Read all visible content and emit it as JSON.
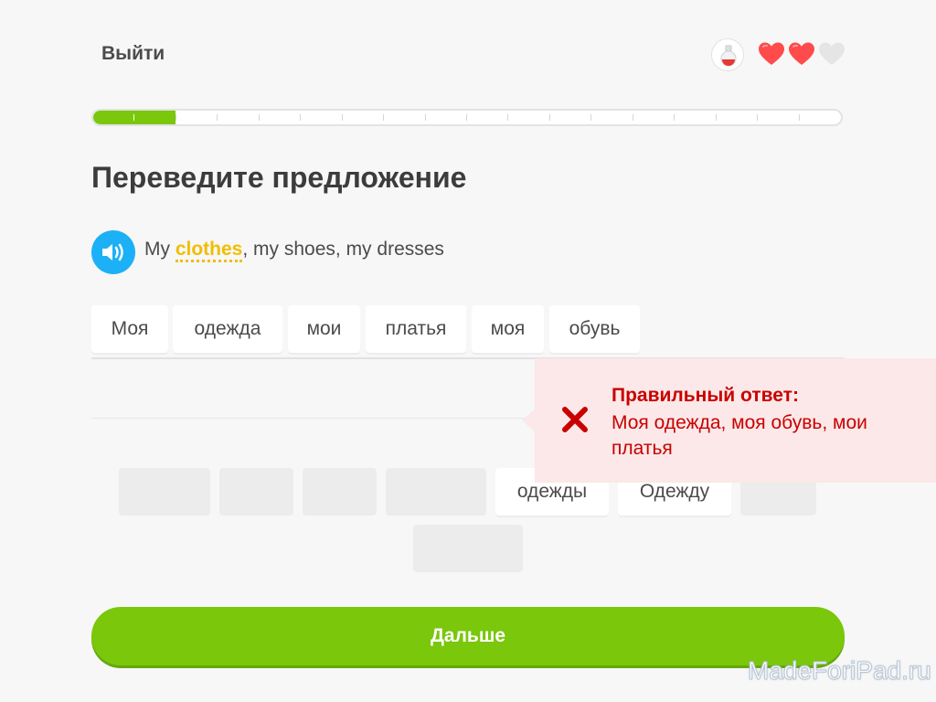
{
  "header": {
    "quit_label": "Выйти",
    "hearts": {
      "total": 3,
      "remaining": 2
    }
  },
  "progress": {
    "fraction": 0.11,
    "segments": 18
  },
  "exercise": {
    "instruction": "Переведите предложение",
    "prompt_before": "My ",
    "prompt_hint": "clothes",
    "prompt_after": ", my shoes, my dresses"
  },
  "answer_words": [
    "Моя",
    "одежда",
    "мои",
    "платья",
    "моя",
    "обувь"
  ],
  "word_bank": {
    "row1": [
      "",
      "",
      "",
      "",
      "одежды",
      "Одежду",
      ""
    ],
    "row2": [
      ""
    ]
  },
  "feedback": {
    "heading": "Правильный ответ:",
    "correct_answer": "Моя одежда, моя обувь, мои платья"
  },
  "footer": {
    "continue_label": "Дальше"
  },
  "watermark": "MadeForiPad.ru",
  "colors": {
    "accent_green": "#7ac70c",
    "speaker_blue": "#1cb0f6",
    "hint_yellow": "#f2bd00",
    "error_red": "#c90000",
    "error_bg": "#fce8e8",
    "heart_red": "#ff4b4b"
  },
  "icons": {
    "potion": "potion-icon",
    "heart": "heart-icon",
    "speaker": "speaker-icon",
    "wrong": "close-icon"
  }
}
